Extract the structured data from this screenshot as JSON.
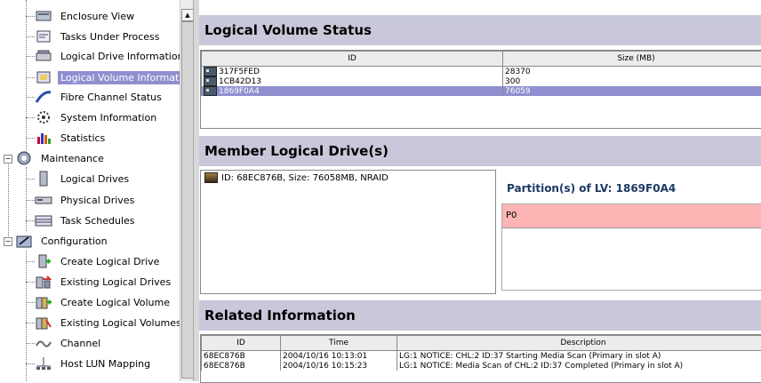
{
  "tree": {
    "items": [
      {
        "label": "Enclosure View",
        "icon": "enclosure-icon",
        "selected": false
      },
      {
        "label": "Tasks Under Process",
        "icon": "tasks-icon",
        "selected": false
      },
      {
        "label": "Logical Drive Information",
        "icon": "logical-drive-icon",
        "selected": false
      },
      {
        "label": "Logical Volume Information",
        "icon": "logical-volume-icon",
        "selected": true
      },
      {
        "label": "Fibre Channel Status",
        "icon": "fibre-channel-icon",
        "selected": false
      },
      {
        "label": "System Information",
        "icon": "system-info-icon",
        "selected": false
      },
      {
        "label": "Statistics",
        "icon": "statistics-icon",
        "selected": false
      },
      {
        "label": "Maintenance",
        "icon": "maintenance-icon",
        "selected": false
      },
      {
        "label": "Logical Drives",
        "icon": "logical-drives-icon",
        "selected": false
      },
      {
        "label": "Physical Drives",
        "icon": "physical-drives-icon",
        "selected": false
      },
      {
        "label": "Task Schedules",
        "icon": "task-schedules-icon",
        "selected": false
      },
      {
        "label": "Configuration",
        "icon": "configuration-icon",
        "selected": false
      },
      {
        "label": "Create Logical Drive",
        "icon": "create-logical-drive-icon",
        "selected": false
      },
      {
        "label": "Existing Logical Drives",
        "icon": "existing-logical-drives-icon",
        "selected": false
      },
      {
        "label": "Create Logical Volume",
        "icon": "create-logical-volume-icon",
        "selected": false
      },
      {
        "label": "Existing Logical Volumes",
        "icon": "existing-logical-volumes-icon",
        "selected": false
      },
      {
        "label": "Channel",
        "icon": "channel-icon",
        "selected": false
      },
      {
        "label": "Host LUN Mapping",
        "icon": "host-lun-mapping-icon",
        "selected": false
      }
    ]
  },
  "lv_status": {
    "title": "Logical Volume Status",
    "columns": [
      "ID",
      "Size (MB)"
    ],
    "rows": [
      {
        "id": "317F5FED",
        "size": "28370",
        "selected": false
      },
      {
        "id": "1CB42D13",
        "size": "300",
        "selected": false
      },
      {
        "id": "1869F0A4",
        "size": "76059",
        "selected": true
      }
    ]
  },
  "members": {
    "title": "Member Logical Drive(s)",
    "items": [
      "ID: 68EC876B, Size: 76058MB, NRAID"
    ],
    "partitions_title": "Partition(s) of LV: 1869F0A4",
    "partitions": [
      "P0"
    ]
  },
  "related": {
    "title": "Related Information",
    "columns": [
      "ID",
      "Time",
      "Description"
    ],
    "rows": [
      {
        "id": "68EC876B",
        "time": "2004/10/16 10:13:01",
        "desc": "LG:1 NOTICE: CHL:2 ID:37 Starting Media Scan (Primary in slot A)"
      },
      {
        "id": "68EC876B",
        "time": "2004/10/16 10:15:23",
        "desc": "LG:1 NOTICE: Media Scan of CHL:2 ID:37 Completed (Primary in slot A)"
      }
    ]
  },
  "colors": {
    "selection": "#8f8fd0",
    "section_bg": "#c8c8da",
    "partition_bg": "#ffb4b4"
  }
}
